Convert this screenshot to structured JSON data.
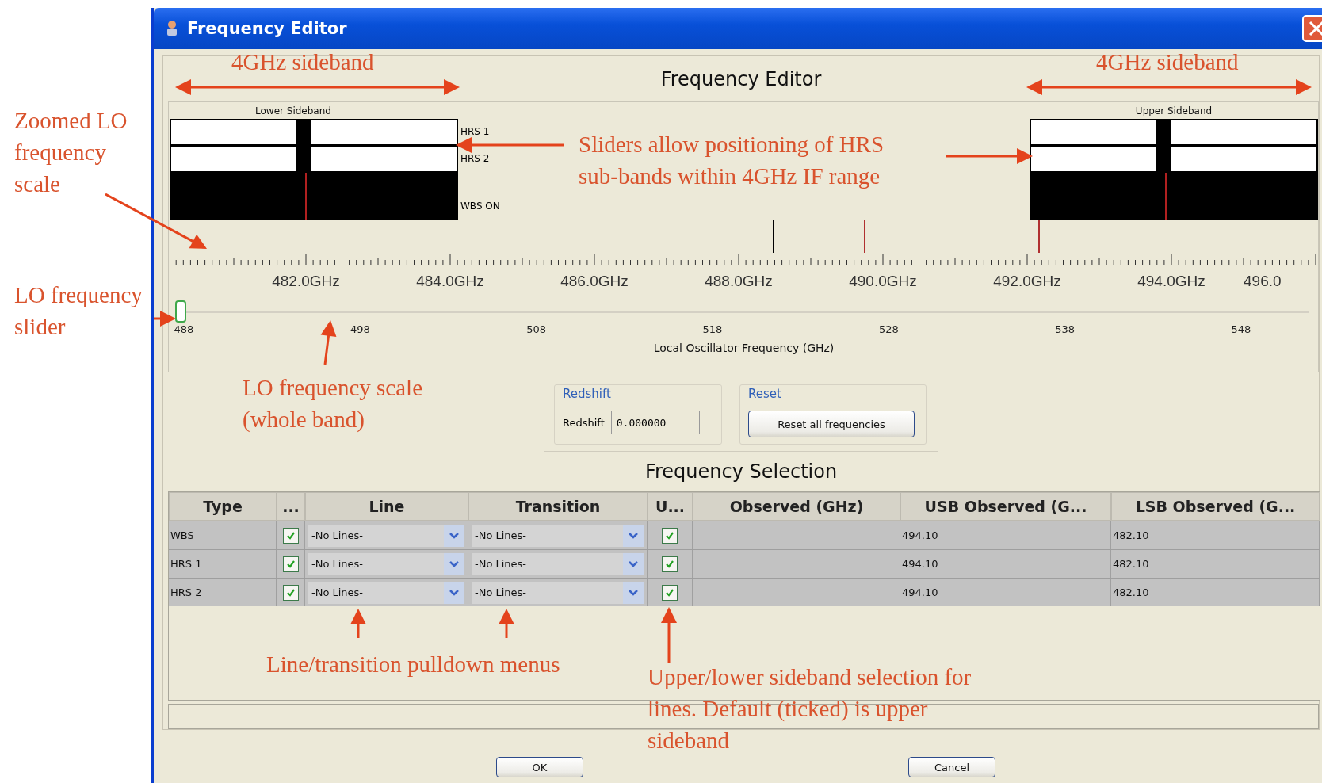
{
  "window": {
    "title": "Frequency Editor"
  },
  "heading": "Frequency Editor",
  "lower_sideband": {
    "title": "Lower Sideband",
    "labels": [
      "HRS 1",
      "HRS 2",
      "WBS ON"
    ]
  },
  "upper_sideband": {
    "title": "Upper Sideband"
  },
  "zoom_scale": {
    "labels": [
      "482.0GHz",
      "484.0GHz",
      "486.0GHz",
      "488.0GHz",
      "490.0GHz",
      "492.0GHz",
      "494.0GHz",
      "496.0"
    ]
  },
  "lo_slider": {
    "level": 0,
    "labels": [
      "488",
      "498",
      "508",
      "518",
      "528",
      "538",
      "548"
    ],
    "title": "Local Oscillator Frequency (GHz)"
  },
  "redshift": {
    "title": "Redshift",
    "label": "Redshift",
    "value": "0.000000"
  },
  "reset": {
    "title": "Reset",
    "button": "Reset all frequencies"
  },
  "frequency_selection": {
    "title": "Frequency Selection",
    "columns": [
      "Type",
      "...",
      "Line",
      "Transition",
      "U...",
      "Observed (GHz)",
      "USB Observed (G...",
      "LSB Observed (G..."
    ],
    "rows": [
      {
        "type": "WBS",
        "enabled": true,
        "line": "-No Lines-",
        "transition": "-No Lines-",
        "upper": true,
        "usb_observed": "494.10",
        "lsb_observed": "482.10"
      },
      {
        "type": "HRS 1",
        "enabled": true,
        "line": "-No Lines-",
        "transition": "-No Lines-",
        "upper": true,
        "usb_observed": "494.10",
        "lsb_observed": "482.10"
      },
      {
        "type": "HRS 2",
        "enabled": true,
        "line": "-No Lines-",
        "transition": "-No Lines-",
        "upper": true,
        "usb_observed": "494.10",
        "lsb_observed": "482.10"
      }
    ]
  },
  "buttons": [
    "OK",
    "Cancel"
  ],
  "annotations": [
    {
      "text": "4GHz sideband"
    },
    {
      "text": "4GHz sideband"
    },
    {
      "text": "Zoomed LO frequency scale"
    },
    {
      "text": "LO frequency slider"
    },
    {
      "text": "Sliders allow positioning of HRS sub-bands within 4GHz IF range"
    },
    {
      "text": "LO frequency scale (whole band)"
    },
    {
      "text": "Line/transition pulldown menus"
    },
    {
      "text": "Upper/lower sideband selection for lines. Default (ticked) is upper sideband"
    }
  ]
}
